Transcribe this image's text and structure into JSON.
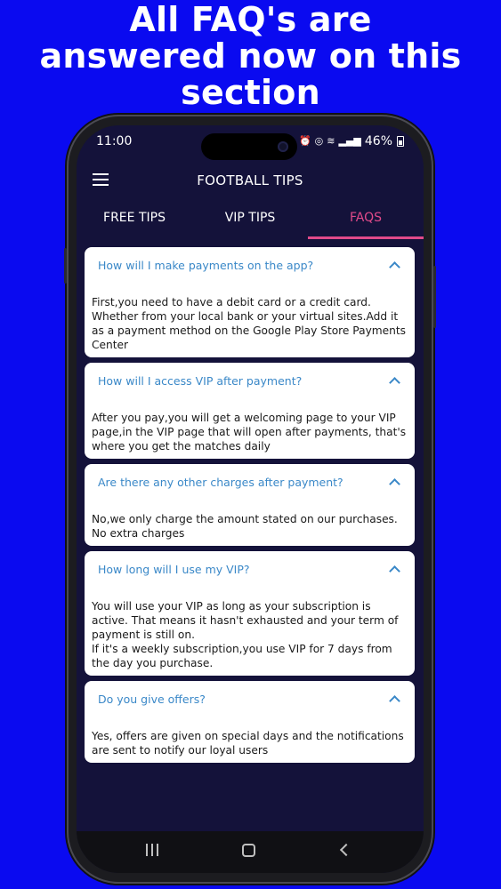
{
  "headline": [
    "All FAQ's are",
    "answered now on this",
    "section"
  ],
  "status": {
    "time": "11:00",
    "battery": "46%",
    "icons": [
      "alarm-icon",
      "hotspot-icon",
      "wifi-icon",
      "signal-icon",
      "battery-icon"
    ]
  },
  "app": {
    "title": "FOOTBALL TIPS",
    "menu_icon": "hamburger-menu-icon"
  },
  "tabs": [
    {
      "label": "FREE TIPS",
      "active": false
    },
    {
      "label": "VIP TIPS",
      "active": false
    },
    {
      "label": "FAQS",
      "active": true
    }
  ],
  "faqs": [
    {
      "question": "How will I make payments on the app?",
      "answer": "First,you need to have a debit card or a credit card.\nWhether from your local bank or your virtual sites.Add it\nas a payment method on the Google Play Store Payments\nCenter"
    },
    {
      "question": "How will I access VIP after payment?",
      "answer": "After you pay,you will get a welcoming page to your VIP\npage,in the VIP page that will open after payments, that's\nwhere you get the matches daily"
    },
    {
      "question": "Are there any other charges after payment?",
      "answer": "No,we only charge the amount stated on our purchases.\nNo extra charges"
    },
    {
      "question": "How long will I use my VIP?",
      "answer": " You will use your VIP as long as your subscription is\nactive. That means it hasn't exhausted and your term of\npayment is still on.\nIf it's a weekly subscription,you use VIP for 7 days from\nthe day you purchase."
    },
    {
      "question": "Do you give offers?",
      "answer": "Yes, offers are given on special days and the notifications\nare sent to notify our loyal users"
    }
  ],
  "colors": {
    "background": "#0a0af0",
    "screen": "#14123a",
    "accent": "#e14a8a",
    "question": "#3a88c8"
  }
}
